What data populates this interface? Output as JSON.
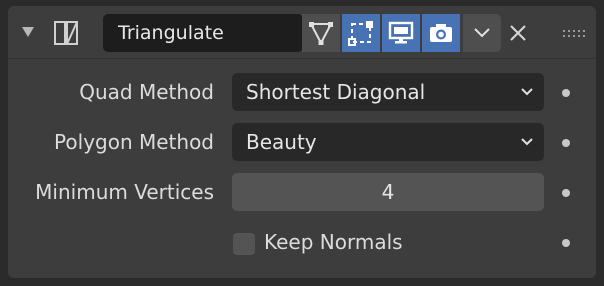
{
  "modifier": {
    "name": "Triangulate",
    "header_icons": [
      "collapse-arrow-icon",
      "triangulate-modifier-icon",
      "on-cage-icon",
      "edit-mode-icon",
      "viewport-display-icon",
      "render-camera-icon",
      "chevron-down-icon",
      "close-icon",
      "drag-grip-icon"
    ]
  },
  "fields": {
    "quad_method": {
      "label": "Quad Method",
      "value": "Shortest Diagonal"
    },
    "polygon_method": {
      "label": "Polygon Method",
      "value": "Beauty"
    },
    "minimum_vertices": {
      "label": "Minimum Vertices",
      "value": "4"
    },
    "keep_normals": {
      "label": "Keep Normals",
      "checked": false
    }
  },
  "colors": {
    "active_toggle": "#4772b3",
    "panel": "#3d3d3d",
    "background": "#2b2b2b"
  }
}
